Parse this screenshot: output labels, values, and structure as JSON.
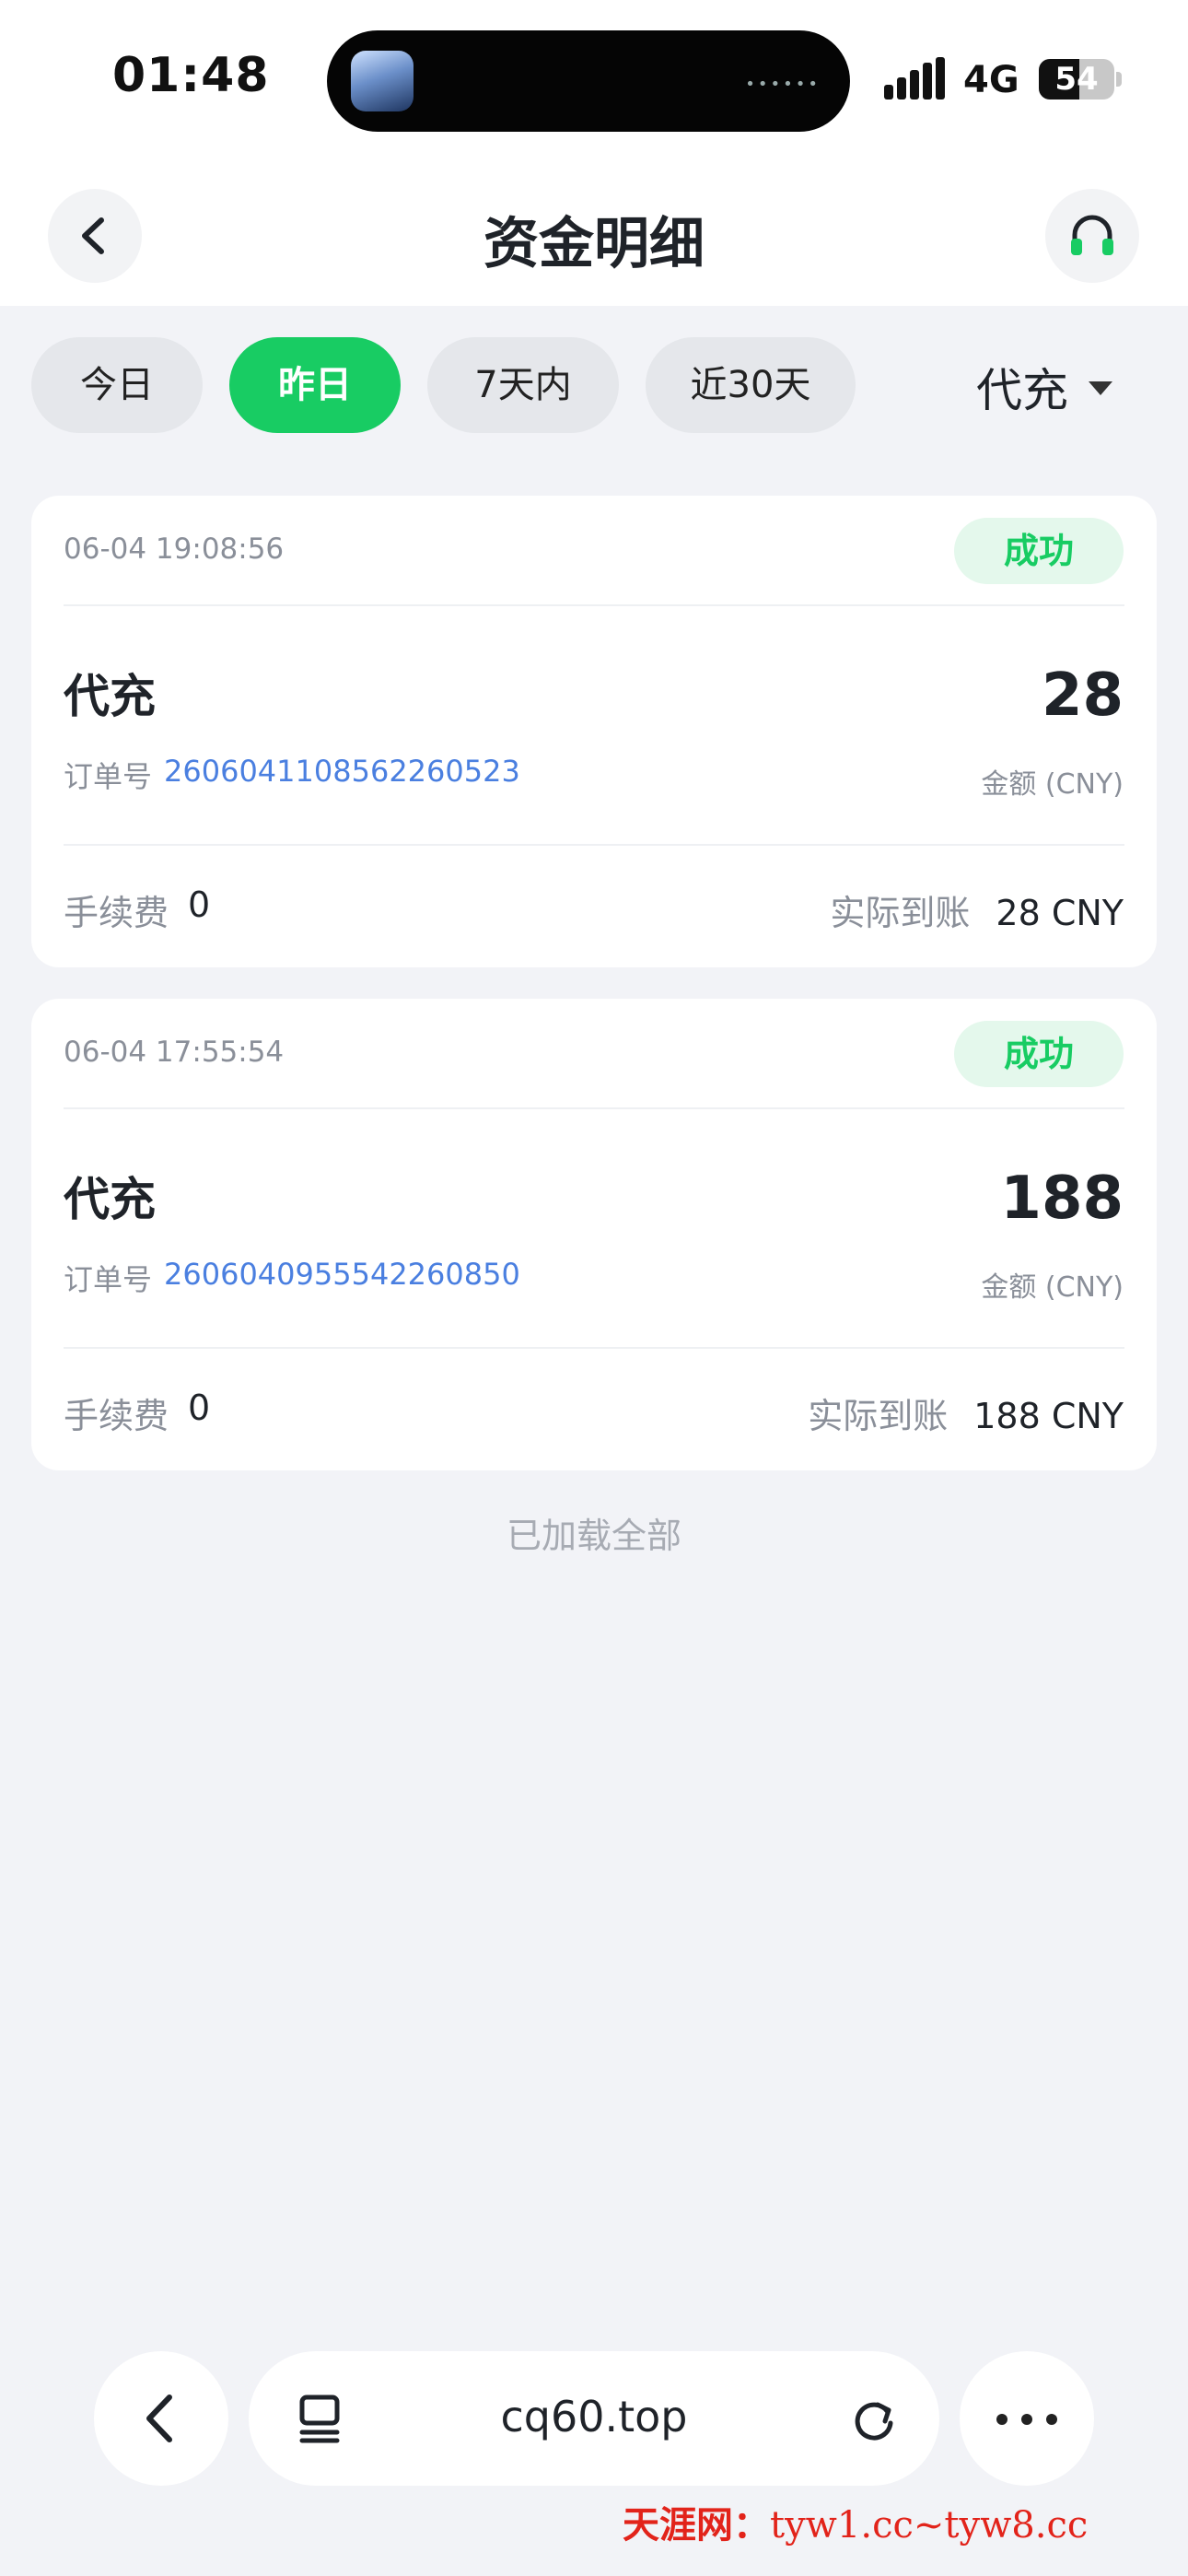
{
  "status_bar": {
    "time": "01:48",
    "network": "4G",
    "battery_level": "54",
    "battery_fraction": 0.54
  },
  "header": {
    "title": "资金明细",
    "back_icon": "chevron-left-icon",
    "support_icon": "headphones-icon"
  },
  "filters": {
    "chips": [
      {
        "label": "今日",
        "active": false
      },
      {
        "label": "昨日",
        "active": true
      },
      {
        "label": "7天内",
        "active": false
      },
      {
        "label": "近30天",
        "active": false
      }
    ],
    "type_select": "代充"
  },
  "records": [
    {
      "time": "06-04 19:08:56",
      "status": "成功",
      "type": "代充",
      "order_label": "订单号",
      "order_no": "2606041108562260523",
      "amount": "28",
      "amount_label": "金额 (CNY)",
      "fee_label": "手续费",
      "fee": "0",
      "actual_label": "实际到账",
      "actual": "28 CNY"
    },
    {
      "time": "06-04 17:55:54",
      "status": "成功",
      "type": "代充",
      "order_label": "订单号",
      "order_no": "2606040955542260850",
      "amount": "188",
      "amount_label": "金额 (CNY)",
      "fee_label": "手续费",
      "fee": "0",
      "actual_label": "实际到账",
      "actual": "188 CNY"
    }
  ],
  "list_footer": "已加载全部",
  "browser": {
    "url": "cq60.top",
    "back_icon": "chevron-left-icon",
    "tabs_icon": "tabs-icon",
    "reload_icon": "reload-icon",
    "more_icon": "more-dots-icon"
  },
  "watermark": {
    "label": "天涯网：",
    "sites": "tyw1.cc~tyw8.cc"
  },
  "colors": {
    "accent_green": "#18cc63",
    "badge_bg": "#e4f8ec",
    "link_blue": "#4a7fe0",
    "page_bg": "#f2f3f7"
  }
}
